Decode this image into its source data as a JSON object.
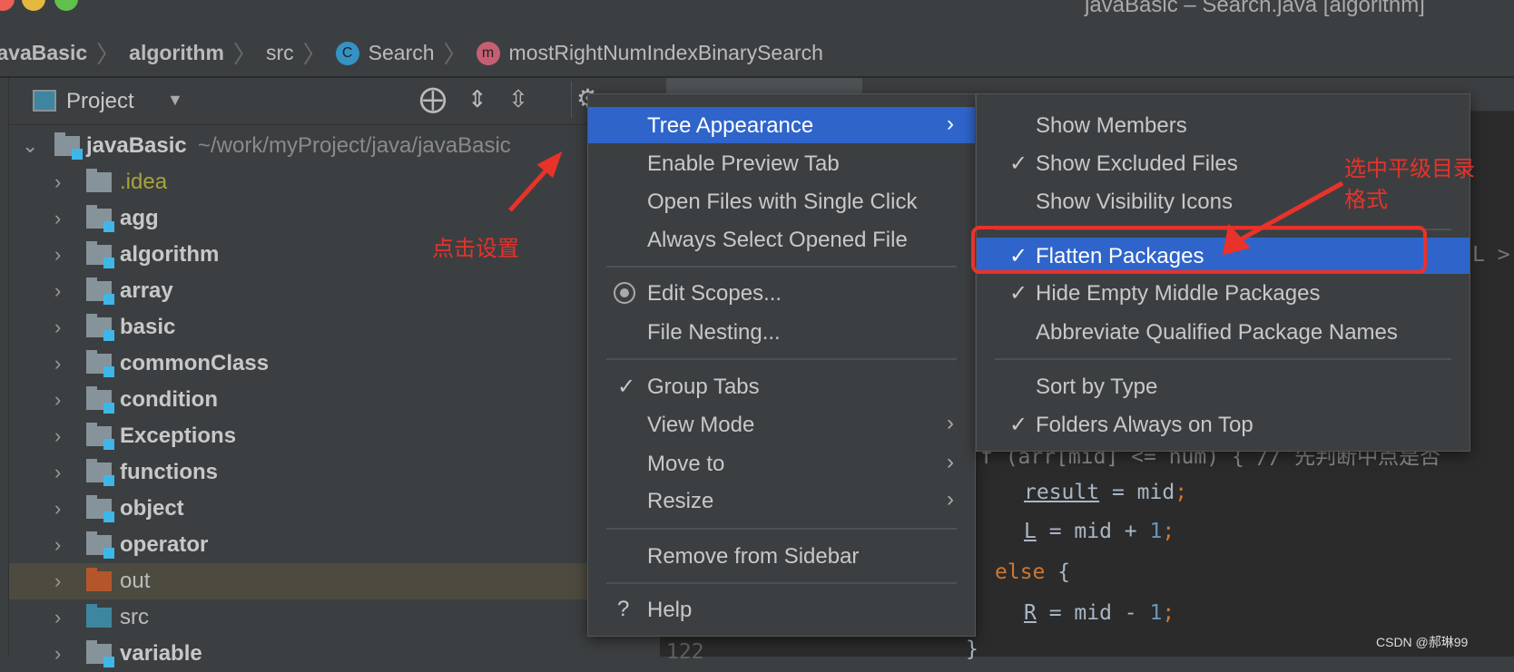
{
  "window": {
    "title": "javaBasic – Search.java [algorithm]"
  },
  "breadcrumb": {
    "items": [
      "javaBasic",
      "algorithm",
      "src",
      "Search",
      "mostRightNumIndexBinarySearch"
    ],
    "class_icon": "C",
    "method_icon": "m"
  },
  "project_panel": {
    "title": "Project",
    "icons": [
      "locate-icon",
      "expand-all-icon",
      "collapse-all-icon",
      "gear-icon"
    ],
    "root": {
      "name": "javaBasic",
      "path": "~/work/myProject/java/javaBasic"
    },
    "items": [
      {
        "name": ".idea",
        "type": "plain"
      },
      {
        "name": "agg",
        "type": "module"
      },
      {
        "name": "algorithm",
        "type": "module"
      },
      {
        "name": "array",
        "type": "module"
      },
      {
        "name": "basic",
        "type": "module"
      },
      {
        "name": "commonClass",
        "type": "module"
      },
      {
        "name": "condition",
        "type": "module"
      },
      {
        "name": "Exceptions",
        "type": "module"
      },
      {
        "name": "functions",
        "type": "module"
      },
      {
        "name": "object",
        "type": "module"
      },
      {
        "name": "operator",
        "type": "module"
      },
      {
        "name": "out",
        "type": "excluded"
      },
      {
        "name": "src",
        "type": "source"
      },
      {
        "name": "variable",
        "type": "module"
      }
    ]
  },
  "context_menu": {
    "items": [
      {
        "label": "Tree Appearance",
        "submenu": true,
        "selected": true
      },
      {
        "label": "Enable Preview Tab"
      },
      {
        "label": "Open Files with Single Click"
      },
      {
        "label": "Always Select Opened File"
      },
      {
        "label": "Edit Scopes...",
        "icon": "radio-icon"
      },
      {
        "label": "File Nesting..."
      },
      {
        "label": "Group Tabs",
        "checked": true
      },
      {
        "label": "View Mode",
        "submenu": true
      },
      {
        "label": "Move to",
        "submenu": true
      },
      {
        "label": "Resize",
        "submenu": true
      },
      {
        "label": "Remove from Sidebar"
      },
      {
        "label": "Help",
        "icon": "?"
      }
    ]
  },
  "submenu": {
    "items": [
      {
        "label": "Show Members"
      },
      {
        "label": "Show Excluded Files",
        "checked": true
      },
      {
        "label": "Show Visibility Icons"
      },
      {
        "label": "Flatten Packages",
        "checked": true,
        "selected": true
      },
      {
        "label": "Hide Empty Middle Packages",
        "checked": true
      },
      {
        "label": "Abbreviate Qualified Package Names"
      },
      {
        "label": "Sort by Type"
      },
      {
        "label": "Folders Always on Top",
        "checked": true
      }
    ]
  },
  "editor": {
    "lines": {
      "l1": "f (arr[mid] <= num) { // 先判断中点是否",
      "l2a": "result",
      "l2b": " = mid",
      "l2c": ";",
      "l3a": "L",
      "l3b": " = mid + ",
      "l3c": "1",
      "l3d": ";",
      "l4a": "else",
      "l4b": " {",
      "l5a": "R",
      "l5b": " = mid - ",
      "l5c": "1",
      "l5d": ";",
      "l6": "}",
      "peek": "L >"
    },
    "line_number": "122"
  },
  "annotations": {
    "click_settings": "点击设置",
    "select_flatten_1": "选中平级目录",
    "select_flatten_2": "格式"
  },
  "watermark": "CSDN @郝琳99",
  "colors": {
    "selection": "#2f65ca",
    "annotation": "#e8322a",
    "module_badge": "#3fb6e8",
    "excluded_folder": "#b4562c"
  }
}
